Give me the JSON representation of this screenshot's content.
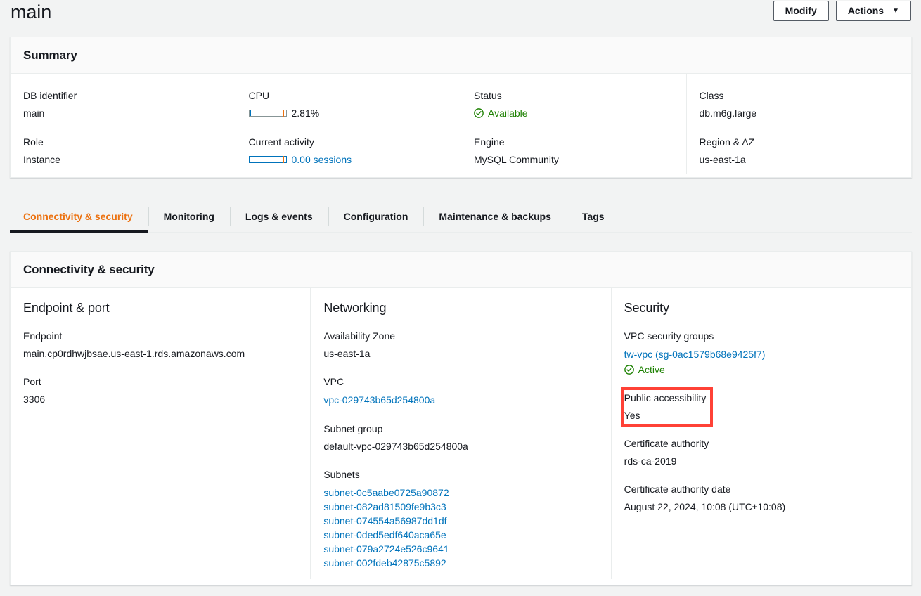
{
  "header": {
    "title": "main",
    "modify_label": "Modify",
    "actions_label": "Actions",
    "actions_caret": "▼"
  },
  "summary": {
    "card_title": "Summary",
    "columns": [
      {
        "fields": [
          {
            "label": "DB identifier",
            "value": "main",
            "type": "text"
          },
          {
            "label": "Role",
            "value": "Instance",
            "type": "text"
          }
        ]
      },
      {
        "fields": [
          {
            "label": "CPU",
            "value": "2.81%",
            "type": "gauge",
            "fill_percent": 4,
            "marker_percent": 93
          },
          {
            "label": "Current activity",
            "value": "0.00 sessions",
            "type": "gauge-link",
            "fill_percent": 0,
            "marker_percent": 93
          }
        ]
      },
      {
        "fields": [
          {
            "label": "Status",
            "value": "Available",
            "type": "status",
            "icon": "check-circle-icon",
            "color": "#1d8102"
          },
          {
            "label": "Engine",
            "value": "MySQL Community",
            "type": "text"
          }
        ]
      },
      {
        "fields": [
          {
            "label": "Class",
            "value": "db.m6g.large",
            "type": "text"
          },
          {
            "label": "Region & AZ",
            "value": "us-east-1a",
            "type": "text"
          }
        ]
      }
    ]
  },
  "tabs": [
    {
      "label": "Connectivity & security",
      "active": true
    },
    {
      "label": "Monitoring",
      "active": false
    },
    {
      "label": "Logs & events",
      "active": false
    },
    {
      "label": "Configuration",
      "active": false
    },
    {
      "label": "Maintenance & backups",
      "active": false
    },
    {
      "label": "Tags",
      "active": false
    }
  ],
  "connectivity": {
    "card_title": "Connectivity & security",
    "endpoint_port": {
      "heading": "Endpoint & port",
      "endpoint_label": "Endpoint",
      "endpoint_value": "main.cp0rdhwjbsae.us-east-1.rds.amazonaws.com",
      "port_label": "Port",
      "port_value": "3306"
    },
    "networking": {
      "heading": "Networking",
      "az_label": "Availability Zone",
      "az_value": "us-east-1a",
      "vpc_label": "VPC",
      "vpc_value": "vpc-029743b65d254800a",
      "subnet_group_label": "Subnet group",
      "subnet_group_value": "default-vpc-029743b65d254800a",
      "subnets_label": "Subnets",
      "subnets": [
        "subnet-0c5aabe0725a90872",
        "subnet-082ad81509fe9b3c3",
        "subnet-074554a56987dd1df",
        "subnet-0ded5edf640aca65e",
        "subnet-079a2724e526c9641",
        "subnet-002fdeb42875c5892"
      ]
    },
    "security": {
      "heading": "Security",
      "sg_label": "VPC security groups",
      "sg_value": "tw-vpc (sg-0ac1579b68e9425f7)",
      "sg_status": "Active",
      "public_label": "Public accessibility",
      "public_value": "Yes",
      "ca_label": "Certificate authority",
      "ca_value": "rds-ca-2019",
      "ca_date_label": "Certificate authority date",
      "ca_date_value": "August 22, 2024, 10:08 (UTC±10:08)"
    }
  },
  "colors": {
    "accent_orange": "#ec7211",
    "link_blue": "#0073bb",
    "status_green": "#1d8102",
    "highlight_red": "#ff4136",
    "page_bg": "#f2f3f3"
  }
}
